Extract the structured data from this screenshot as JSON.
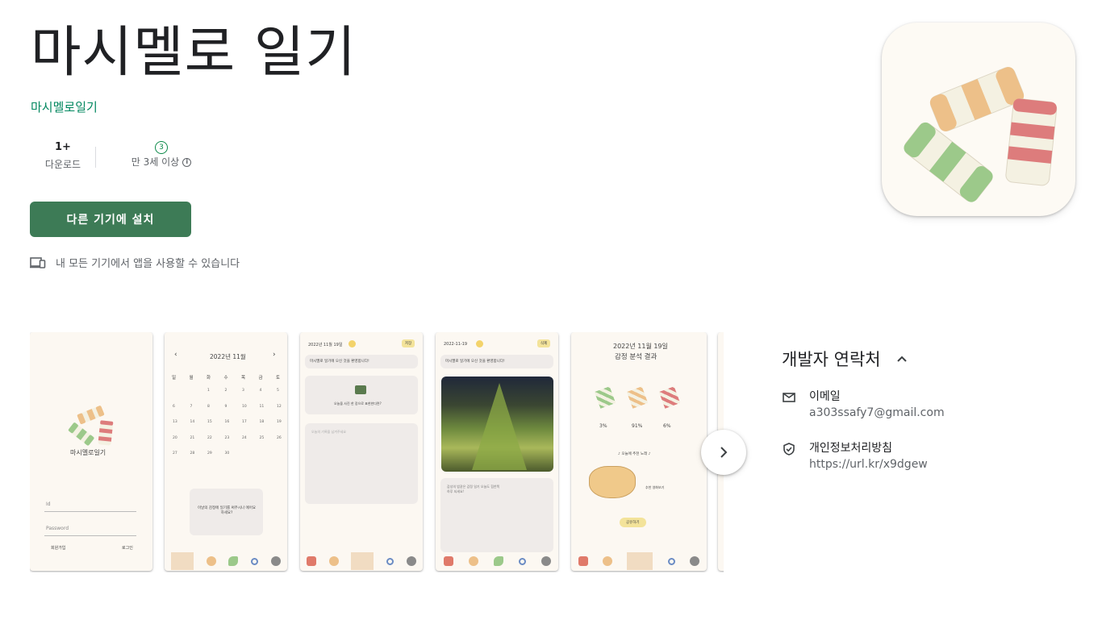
{
  "app": {
    "title": "마시멜로 일기",
    "developer": "마시멜로일기"
  },
  "stats": {
    "downloads_value": "1+",
    "downloads_label": "다운로드",
    "rating_badge": "3",
    "rating_label": "만 3세 이상"
  },
  "actions": {
    "install_label": "다른 기기에 설치",
    "device_note": "내 모든 기기에서 앱을 사용할 수 있습니다"
  },
  "screenshots": {
    "login": {
      "app_name": "마시멜로일기",
      "id_placeholder": "Id",
      "password_placeholder": "Password",
      "signup": "회원가입",
      "login": "로그인"
    },
    "calendar": {
      "month": "2022년 11월",
      "weekdays": [
        "일",
        "월",
        "화",
        "수",
        "목",
        "금",
        "토"
      ],
      "days": [
        "1",
        "2",
        "3",
        "4",
        "5",
        "6",
        "7",
        "8",
        "9",
        "10",
        "11",
        "12",
        "13",
        "14",
        "15",
        "16",
        "17",
        "18",
        "19",
        "20",
        "21",
        "22",
        "23",
        "24",
        "25",
        "26",
        "27",
        "28",
        "29",
        "30"
      ],
      "empty_msg": "이날의 감정에 일기를 써주시나 에어요하세요?"
    },
    "write": {
      "date": "2022년 11월 19일",
      "save": "저장",
      "prompt": "마시멜로 일기에 오신 것을 환영합니다!",
      "photo_msg": "오늘을 사진 한 장으로 표현한다면?",
      "text_placeholder": "오늘의 기록을 남겨주세요"
    },
    "view": {
      "date": "2022-11-19",
      "delete": "삭제",
      "prompt": "마시멜로 일기에 오신 것을 환영합니다!",
      "entry_text": "감성의 밤같은 감정 일기 오늘도 힘찬쪽 하루 되세요!"
    },
    "analysis": {
      "date": "2022년 11월 19일",
      "title": "감정 분석 결과",
      "percents": [
        "3%",
        "91%",
        "6%"
      ],
      "music_label": "오늘에 추천 노래",
      "movie_label": "추천 영화보기",
      "share": "공유하기"
    }
  },
  "contact": {
    "title": "개발자 연락처",
    "email_label": "이메일",
    "email_value": "a303ssafy7@gmail.com",
    "privacy_label": "개인정보처리방침",
    "privacy_value": "https://url.kr/x9dgew"
  },
  "colors": {
    "brand_green": "#3d7b56",
    "developer_green": "#01875f",
    "mallow_green": "#9cc98a",
    "mallow_orange": "#edc089",
    "mallow_red": "#dd7c7c",
    "mallow_cream": "#f4f1e2"
  }
}
